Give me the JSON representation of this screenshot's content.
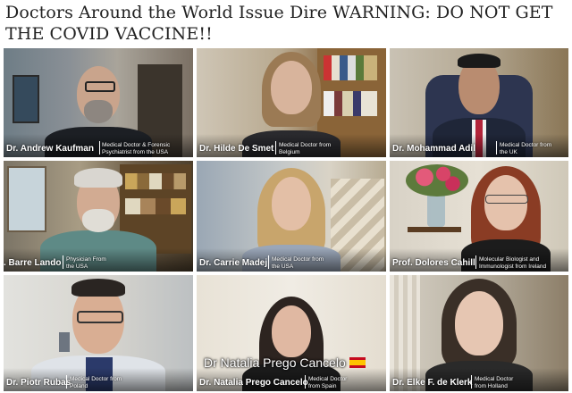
{
  "headline": "Doctors Around the World Issue Dire WARNING: DO NOT GET THE COVID VACCINE!!",
  "tiles": [
    {
      "name": "Dr. Andrew Kaufman",
      "role": "Medical Doctor & Forensic Psychiatrist from the USA"
    },
    {
      "name": "Dr. Hilde De Smet",
      "role": "Medical Doctor from Belgium"
    },
    {
      "name": "Dr. Mohammad Adil",
      "role": "Medical Doctor from the UK"
    },
    {
      "name": ". Barre Lando",
      "role": "Physician From the USA"
    },
    {
      "name": "Dr. Carrie Madej",
      "role": "Medical Doctor from the USA"
    },
    {
      "name": "Prof. Dolores Cahill",
      "role": "Molecular Biologist and Immunologist from Ireland"
    },
    {
      "name": "Dr. Piotr Rubas",
      "role": "Medical Doctor from Poland"
    },
    {
      "name": "Dr. Natalia Prego Cancelo",
      "role": "Medical Doctor from Spain",
      "overlay": "Dr Natalia Prego Cancelo"
    },
    {
      "name": "Dr. Elke F. de Klerk",
      "role": "Medical Doctor from Holland"
    }
  ],
  "colors": {
    "headline_text": "#222222",
    "caption_text": "#ffffff",
    "flag_red": "#c60b1e",
    "flag_yellow": "#ffc400"
  },
  "icons": [
    "spain-flag-icon"
  ]
}
